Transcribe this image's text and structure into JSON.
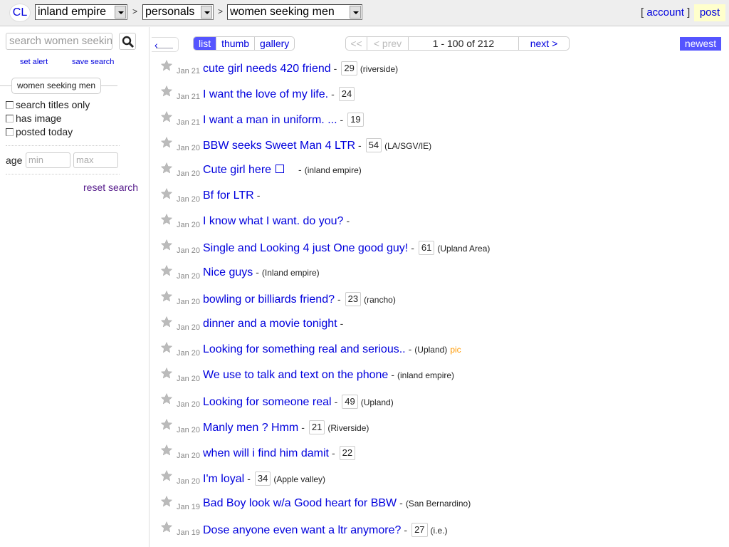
{
  "header": {
    "logo": "CL",
    "location_select": "inland empire",
    "section_select": "personals",
    "category_select": "women seeking men",
    "separator": ">",
    "account_open": "[",
    "account_label": "account",
    "account_close": "]",
    "post_label": "post"
  },
  "sidebar": {
    "search_placeholder": "search women seeking men",
    "search_icon": "search-icon",
    "set_alert": "set alert",
    "save_search": "save search",
    "category_pill": "women seeking men",
    "filters": [
      {
        "label": "search titles only",
        "checked": false
      },
      {
        "label": "has image",
        "checked": false
      },
      {
        "label": "posted today",
        "checked": false
      }
    ],
    "age_label": "age",
    "age_min_placeholder": "min",
    "age_max_placeholder": "max",
    "reset_label": "reset search"
  },
  "toolbar": {
    "back_icon": "left-arrow-icon",
    "views": [
      {
        "label": "list",
        "active": true
      },
      {
        "label": "thumb",
        "active": false
      },
      {
        "label": "gallery",
        "active": false
      }
    ],
    "pager": {
      "first": "<<",
      "prev": "< prev",
      "range": "1 - 100 of 212",
      "next": "next >"
    },
    "sort_label": "newest"
  },
  "colors": {
    "link": "#0000dd",
    "accent": "#5555ff",
    "pic": "#ff9900",
    "post_bg": "#ffffcc"
  },
  "results": [
    {
      "date": "Jan 21",
      "title": "cute girl needs 420 friend",
      "age": "29",
      "hood": "(riverside)",
      "pic": ""
    },
    {
      "date": "Jan 21",
      "title": "I want the love of my life.",
      "age": "24",
      "hood": "",
      "pic": ""
    },
    {
      "date": "Jan 21",
      "title": "I want a man in uniform. ...",
      "age": "19",
      "hood": "",
      "pic": ""
    },
    {
      "date": "Jan 20",
      "title": "BBW seeks Sweet Man 4 LTR",
      "age": "54",
      "hood": "(LA/SGV/IE)",
      "pic": ""
    },
    {
      "date": "Jan 20",
      "title": "Cute girl here",
      "age": "",
      "hood": "(inland empire)",
      "pic": "",
      "box": true
    },
    {
      "date": "Jan 20",
      "title": "Bf for LTR",
      "age": "",
      "hood": "",
      "pic": ""
    },
    {
      "date": "Jan 20",
      "title": "I know what I want. do you?",
      "age": "",
      "hood": "",
      "pic": ""
    },
    {
      "date": "Jan 20",
      "title": "Single and Looking 4 just One good guy!",
      "age": "61",
      "hood": "(Upland Area)",
      "pic": ""
    },
    {
      "date": "Jan 20",
      "title": "Nice guys",
      "age": "",
      "hood": "(Inland empire)",
      "pic": ""
    },
    {
      "date": "Jan 20",
      "title": "bowling or billiards friend?",
      "age": "23",
      "hood": "(rancho)",
      "pic": ""
    },
    {
      "date": "Jan 20",
      "title": "dinner and a movie tonight",
      "age": "",
      "hood": "",
      "pic": ""
    },
    {
      "date": "Jan 20",
      "title": "Looking for something real and serious..",
      "age": "",
      "hood": "(Upland)",
      "pic": "pic"
    },
    {
      "date": "Jan 20",
      "title": "We use to talk and text on the phone",
      "age": "",
      "hood": "(inland empire)",
      "pic": ""
    },
    {
      "date": "Jan 20",
      "title": "Looking for someone real",
      "age": "49",
      "hood": "(Upland)",
      "pic": ""
    },
    {
      "date": "Jan 20",
      "title": "Manly men ? Hmm",
      "age": "21",
      "hood": "(Riverside)",
      "pic": ""
    },
    {
      "date": "Jan 20",
      "title": "when will i find him damit",
      "age": "22",
      "hood": "",
      "pic": ""
    },
    {
      "date": "Jan 20",
      "title": "I'm loyal",
      "age": "34",
      "hood": "(Apple valley)",
      "pic": ""
    },
    {
      "date": "Jan 19",
      "title": "Bad Boy look w/a Good heart for BBW",
      "age": "",
      "hood": "(San Bernardino)",
      "pic": ""
    },
    {
      "date": "Jan 19",
      "title": "Dose anyone even want a ltr anymore?",
      "age": "27",
      "hood": "(i.e.)",
      "pic": ""
    }
  ],
  "dash": "-"
}
